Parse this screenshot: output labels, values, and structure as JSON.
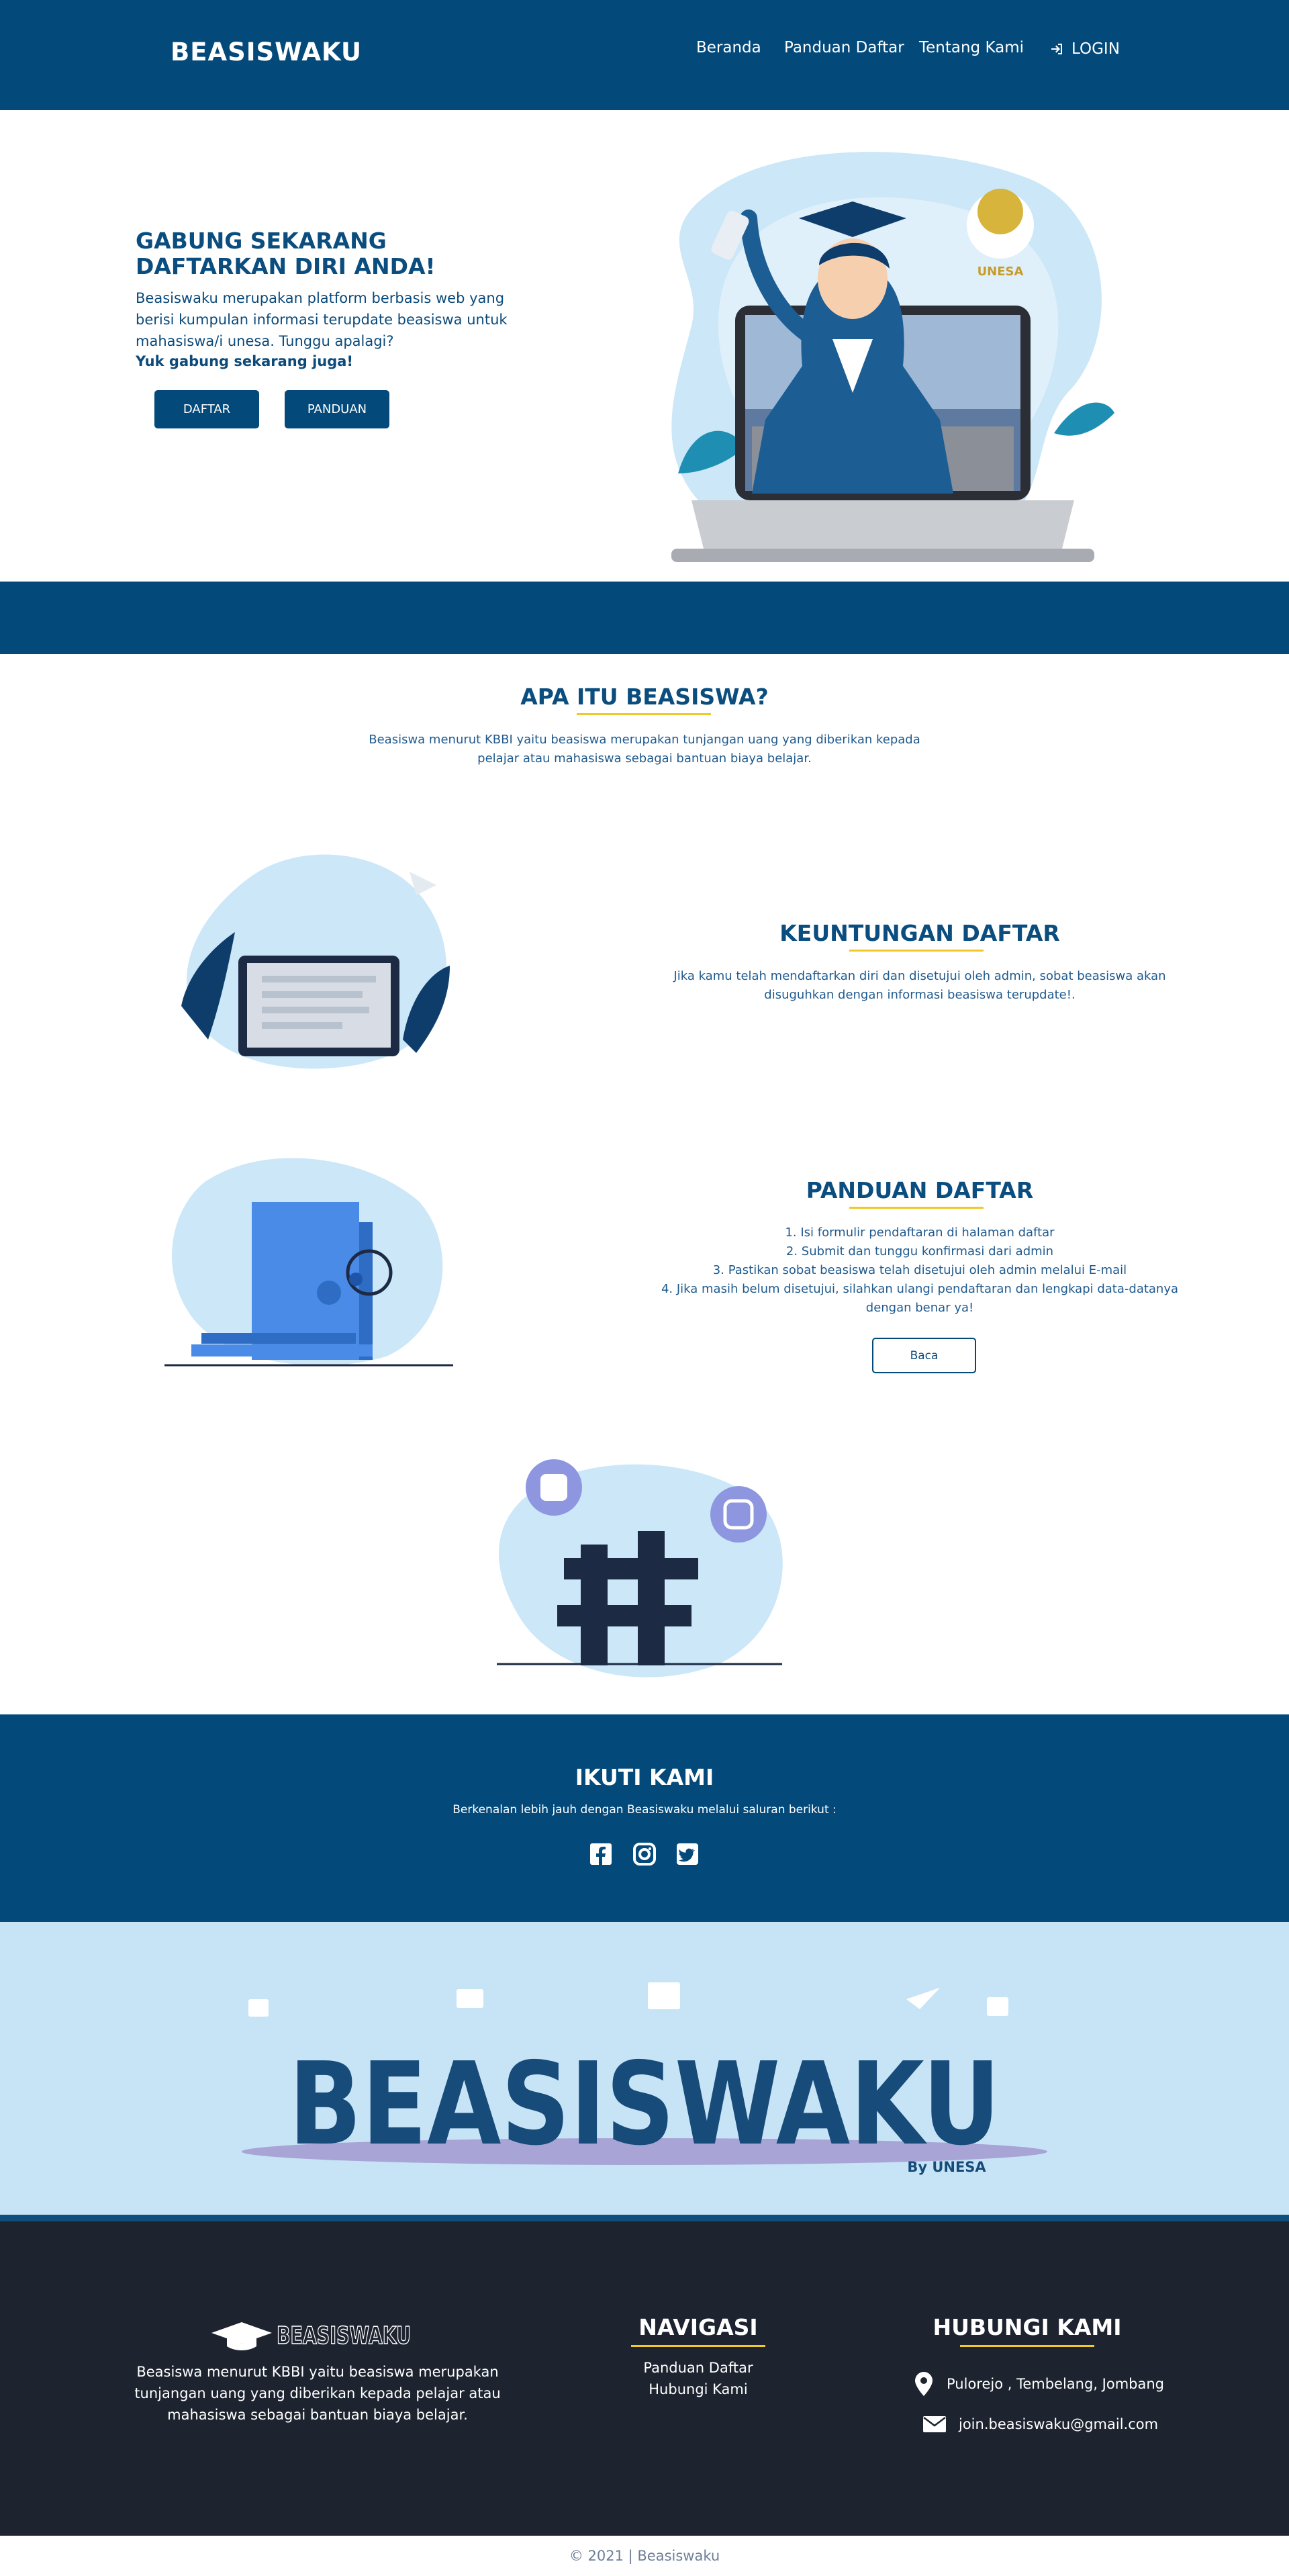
{
  "brand": "BEASISWAKU",
  "nav": {
    "home": "Beranda",
    "guide": "Panduan Daftar",
    "about": "Tentang Kami",
    "login": "LOGIN"
  },
  "hero": {
    "title_line1": "GABUNG SEKARANG",
    "title_line2": "DAFTARKAN DIRI ANDA!",
    "text": "Beasiswaku merupakan platform berbasis web yang berisi kumpulan informasi terupdate beasiswa untuk mahasiswa/i unesa. Tunggu apalagi?",
    "cta": "Yuk gabung sekarang juga!",
    "btn_register": "DAFTAR",
    "btn_guide": "PANDUAN",
    "badge": "UNESA"
  },
  "about": {
    "title": "APA ITU BEASISWA?",
    "text": "Beasiswa menurut KBBI yaitu beasiswa merupakan tunjangan uang yang diberikan kepada pelajar atau mahasiswa sebagai bantuan biaya belajar."
  },
  "benefits": {
    "title": "KEUNTUNGAN DAFTAR",
    "text": "Jika kamu telah mendaftarkan diri dan disetujui oleh admin, sobat beasiswa akan disuguhkan dengan informasi beasiswa terupdate!."
  },
  "guide": {
    "title": "PANDUAN DAFTAR",
    "steps": [
      "1. Isi formulir pendaftaran di halaman daftar",
      "2. Submit dan tunggu konfirmasi dari admin",
      "3. Pastikan sobat beasiswa telah disetujui oleh admin melalui E-mail",
      "4. Jika masih belum disetujui, silahkan ulangi pendaftaran dan lengkapi data-datanya",
      "dengan benar ya!"
    ],
    "btn": "Baca"
  },
  "follow": {
    "title": "IKUTI KAMI",
    "text": "Berkenalan lebih jauh dengan Beasiswaku melalui saluran berikut :"
  },
  "banner": {
    "word": "BEASISWAKU",
    "by": "By UNESA"
  },
  "footer": {
    "logo_text": "BEASISWAKU",
    "about": "Beasiswa menurut KBBI yaitu beasiswa merupakan tunjangan uang yang diberikan kepada pelajar atau mahasiswa sebagai bantuan biaya belajar.",
    "nav_title": "NAVIGASI",
    "nav_links": [
      "Panduan Daftar",
      "Hubungi Kami"
    ],
    "contact_title": "HUBUNGI KAMI",
    "address": "Pulorejo , Tembelang, Jombang",
    "email": "join.beasiswaku@gmail.com"
  },
  "copyright": "© 2021 | Beasiswaku",
  "colors": {
    "primary": "#03497a",
    "accent": "#f0c928",
    "footer": "#1d232f",
    "banner": "#c7e4f7"
  }
}
